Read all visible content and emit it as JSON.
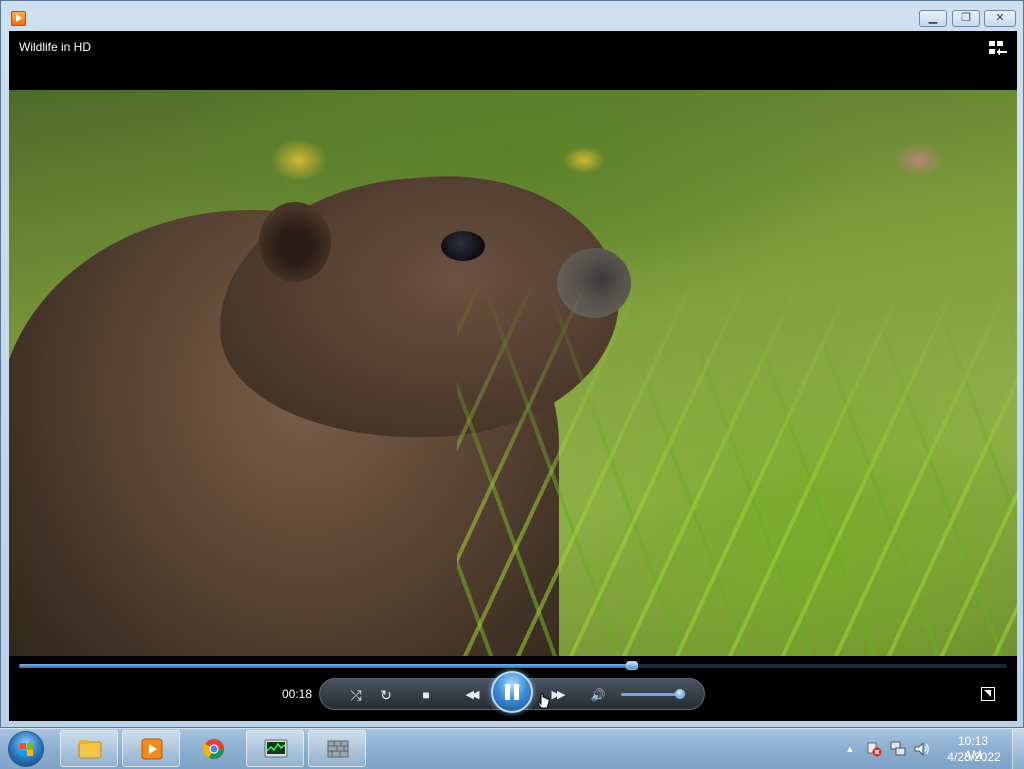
{
  "window": {
    "minimize_glyph": "▁",
    "restore_glyph": "❐",
    "close_glyph": "✕"
  },
  "player": {
    "video_title": "Wildlife in HD",
    "elapsed_time": "00:18",
    "seek_fraction": 0.62,
    "volume_fraction": 0.92,
    "controls": {
      "shuffle_glyph": "⤮",
      "repeat_glyph": "↻",
      "stop_glyph": "■",
      "previous_glyph": "◀◀",
      "next_glyph": "▶▶",
      "mute_glyph": "🔊"
    }
  },
  "taskbar": {
    "clock_time": "10:13 AM",
    "clock_date": "4/23/2022",
    "items": [
      {
        "name": "windows-explorer",
        "icon": "folder-icon",
        "active": true
      },
      {
        "name": "windows-media-player",
        "icon": "media-player-icon",
        "active": true
      },
      {
        "name": "chrome",
        "icon": "chrome-icon",
        "active": false
      },
      {
        "name": "task-manager",
        "icon": "task-manager-icon",
        "active": true
      },
      {
        "name": "firewall",
        "icon": "firewall-icon",
        "active": true
      }
    ],
    "tray_expand_glyph": "▲"
  },
  "colors": {
    "accent": "#3e8fd8",
    "player_background": "#000000",
    "taskbar": "#8fb1d1"
  }
}
